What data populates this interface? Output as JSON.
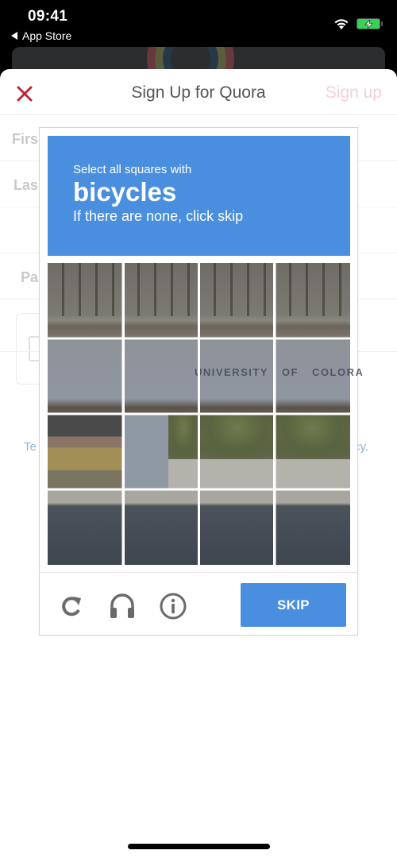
{
  "status_bar": {
    "time": "09:41",
    "back_app": "App Store",
    "icons": [
      "back-triangle-icon",
      "wifi-icon",
      "battery-charging-icon"
    ],
    "battery_color": "#37d158"
  },
  "nav": {
    "close_icon": "close-x-icon",
    "title": "Sign Up for Quora",
    "action": "Sign up",
    "close_color": "#b5283a"
  },
  "form": {
    "labels": [
      "Firs",
      "Las",
      "Pa"
    ],
    "terms_left": "Te",
    "terms_right": "cy."
  },
  "captcha": {
    "instruction": "Select all squares with",
    "target": "bicycles",
    "hint": "If there are none, click skip",
    "header_color": "#4a8edf",
    "image_text": "UNIVERSITY OF COLORA",
    "grid": {
      "rows": 4,
      "cols": 4
    },
    "footer": {
      "icons": [
        "reload-icon",
        "audio-headphones-icon",
        "info-icon"
      ],
      "skip_label": "SKIP"
    }
  }
}
